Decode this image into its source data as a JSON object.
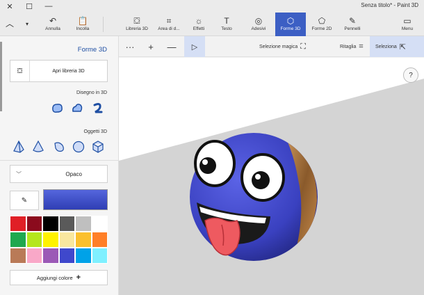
{
  "window": {
    "title": "Senza titolo* - Paint 3D"
  },
  "ribbon": {
    "menu": "Menu",
    "pennelli": "Pennelli",
    "forme2d": "Forme 2D",
    "forme3d": "Forme 3D",
    "adesivi": "Adesivi",
    "testo": "Testo",
    "effetti": "Effetti",
    "area": "Area di d...",
    "libreria": "Libreria 3D",
    "incolla": "Incolla",
    "annulla": "Annulla",
    "accent_color": "#3c5fc4"
  },
  "toolbar": {
    "seleziona": "Seleziona",
    "ritaglia": "Ritaglia",
    "selezione_magica": "Selezione magica",
    "more": "···",
    "plus": "+",
    "minus": "—"
  },
  "panel": {
    "title": "Forme 3D",
    "library_button": "Apri libreria 3D",
    "doodle_heading": "Disegno in 3D",
    "objects_heading": "Oggetti 3D",
    "material": "Opaco",
    "add_color": "Aggiungi colore",
    "current_color": "#3b4bc8",
    "swatches": [
      "#e01f26",
      "#8b0b1d",
      "#000000",
      "#5a5a5a",
      "#bfbfbf",
      "#ffffff",
      "#1fa84f",
      "#b5e61d",
      "#fff200",
      "#f9e79f",
      "#fbc02d",
      "#ff7f27",
      "#b97a57",
      "#f9a8c8",
      "#9b59b6",
      "#3f48cc",
      "#00a2e8",
      "#7ff0ff"
    ]
  },
  "canvas": {
    "help": "?"
  }
}
